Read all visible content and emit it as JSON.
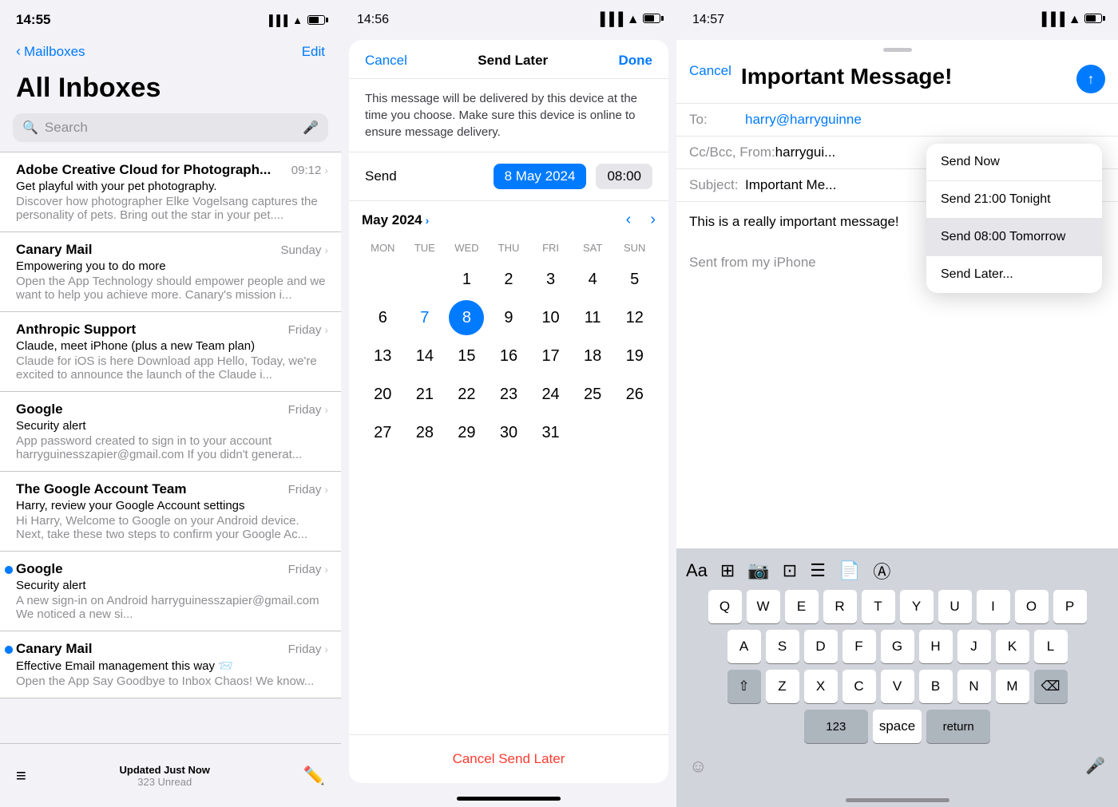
{
  "panel1": {
    "statusBar": {
      "time": "14:55",
      "batteryIcon": "🔲"
    },
    "nav": {
      "back": "Mailboxes",
      "edit": "Edit"
    },
    "title": "All Inboxes",
    "search": {
      "placeholder": "Search"
    },
    "emails": [
      {
        "sender": "Adobe Creative Cloud for Photograph...",
        "time": "09:12",
        "subject": "Get playful with your pet photography.",
        "preview": "Discover how photographer Elke Vogelsang captures the personality of pets. Bring out the star in your pet....",
        "unread": false
      },
      {
        "sender": "Canary Mail",
        "time": "Sunday",
        "subject": "Empowering you to do more",
        "preview": "Open the App Technology should empower people and we want to help you achieve more. Canary's mission i...",
        "unread": false
      },
      {
        "sender": "Anthropic Support",
        "time": "Friday",
        "subject": "Claude, meet iPhone (plus a new Team plan)",
        "preview": "Claude for iOS is here Download app Hello, Today, we're excited to announce the launch of the Claude i...",
        "unread": false
      },
      {
        "sender": "Google",
        "time": "Friday",
        "subject": "Security alert",
        "preview": "App password created to sign in to your account harryguinesszapier@gmail.com If you didn't generat...",
        "unread": false
      },
      {
        "sender": "The Google Account Team",
        "time": "Friday",
        "subject": "Harry, review your Google Account settings",
        "preview": "Hi Harry, Welcome to Google on your Android device. Next, take these two steps to confirm your Google Ac...",
        "unread": false
      },
      {
        "sender": "Google",
        "time": "Friday",
        "subject": "Security alert",
        "preview": "A new sign-in on Android harryguinesszapier@gmail.com We noticed a new si...",
        "unread": true
      },
      {
        "sender": "Canary Mail",
        "time": "Friday",
        "subject": "Effective Email management this way 📨",
        "preview": "Open the App Say Goodbye to Inbox Chaos! We know...",
        "unread": true
      }
    ],
    "bottomBar": {
      "updatedLabel": "Updated Just Now",
      "unreadCount": "323 Unread"
    }
  },
  "panel2": {
    "statusBar": {
      "time": "14:56"
    },
    "modal": {
      "cancelLabel": "Cancel",
      "titleLabel": "Send Later",
      "doneLabel": "Done",
      "description": "This message will be delivered by this device at the time you choose. Make sure this device is online to ensure message delivery.",
      "sendLabel": "Send",
      "selectedDate": "8 May 2024",
      "selectedTime": "08:00",
      "monthLabel": "May 2024",
      "dayHeaders": [
        "MON",
        "TUE",
        "WED",
        "THU",
        "FRI",
        "SAT",
        "SUN"
      ],
      "weeks": [
        [
          "",
          "",
          "1",
          "2",
          "3",
          "4",
          "5"
        ],
        [
          "6",
          "7",
          "8",
          "9",
          "10",
          "11",
          "12"
        ],
        [
          "13",
          "14",
          "15",
          "16",
          "17",
          "18",
          "19"
        ],
        [
          "20",
          "21",
          "22",
          "23",
          "24",
          "25",
          "26"
        ],
        [
          "27",
          "28",
          "29",
          "30",
          "31",
          "",
          ""
        ]
      ],
      "blueTextDays": [
        "7",
        "8"
      ],
      "selectedDay": "8",
      "cancelSendLaterLabel": "Cancel Send Later"
    }
  },
  "panel3": {
    "statusBar": {
      "time": "14:57"
    },
    "compose": {
      "cancelLabel": "Cancel",
      "title": "Important Message!",
      "toLabel": "To:",
      "toValue": "harry@harryguinne",
      "ccLabel": "Cc/Bcc, From:",
      "ccValue": "harrygui...",
      "subjectLabel": "Subject:",
      "subjectValue": "Important Me...",
      "body": "This is a really important message!",
      "signature": "Sent from my iPhone"
    },
    "dropdown": {
      "items": [
        {
          "label": "Send Now",
          "highlighted": false
        },
        {
          "label": "Send 21:00 Tonight",
          "highlighted": false
        },
        {
          "label": "Send 08:00 Tomorrow",
          "highlighted": true
        },
        {
          "label": "Send Later...",
          "highlighted": false
        }
      ]
    },
    "keyboard": {
      "toolbarButtons": [
        "Aa",
        "🖼",
        "📷",
        "⊡",
        "☰",
        "📄",
        "Ⓐ"
      ],
      "row1": [
        "Q",
        "W",
        "E",
        "R",
        "T",
        "Y",
        "U",
        "I",
        "O",
        "P"
      ],
      "row2": [
        "A",
        "S",
        "D",
        "F",
        "G",
        "H",
        "J",
        "K",
        "L"
      ],
      "row3": [
        "Z",
        "X",
        "C",
        "V",
        "B",
        "N",
        "M"
      ],
      "numberLabel": "123",
      "spaceLabel": "space",
      "returnLabel": "return",
      "deleteLabel": "⌫"
    }
  }
}
